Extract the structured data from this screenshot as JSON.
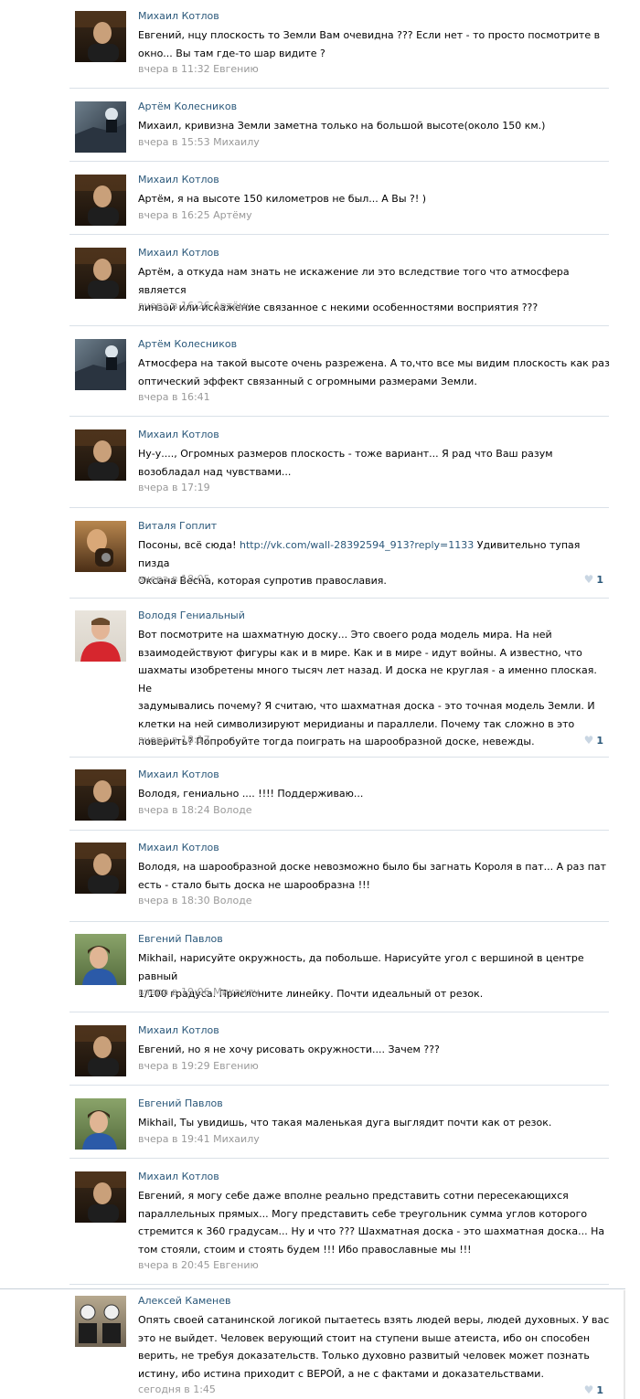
{
  "comments": [
    {
      "author": "Михаил Котлов",
      "avatar": "mikhail",
      "lines": [
        "Евгений, нцу плоскость то Земли Вам очевидна ??? Если нет - то просто посмотрите в",
        "окно... Вы там где-то шар видите ?"
      ],
      "time": "вчера в 11:32",
      "reply_to": "Евгению"
    },
    {
      "author": "Артём Колесников",
      "avatar": "artem",
      "lines": [
        "Михаил, кривизна Земли заметна только на большой высоте(около 150 км.)"
      ],
      "time": "вчера в 15:53",
      "reply_to": "Михаилу"
    },
    {
      "author": "Михаил Котлов",
      "avatar": "mikhail",
      "lines": [
        "Артём, я на высоте 150 километров не был... А Вы ?! )"
      ],
      "time": "вчера в 16:25",
      "reply_to": "Артёму"
    },
    {
      "author": "Михаил Котлов",
      "avatar": "mikhail",
      "lines": [
        "Артём, а откуда нам знать не искажение ли это вследствие того что атмосфера является",
        "линзой или искажение связанное с некими особенностями восприятия ???"
      ],
      "time": "вчера в 16:26",
      "reply_to": "Артёму"
    },
    {
      "author": "Артём Колесников",
      "avatar": "artem",
      "lines": [
        "Атмосфера на такой высоте очень разрежена. А то,что все мы видим плоскость как раз",
        "оптический эффект связанный с огромными размерами Земли."
      ],
      "time": "вчера в 16:41",
      "reply_to": ""
    },
    {
      "author": "Михаил Котлов",
      "avatar": "mikhail",
      "lines": [
        "Ну-у...., Огромных размеров плоскость - тоже вариант... Я рад что Ваш разум",
        "возобладал над чувствами..."
      ],
      "time": "вчера в 17:19",
      "reply_to": ""
    },
    {
      "author": "Виталя Гоплит",
      "avatar": "vitalya",
      "lines_html": true,
      "line1_pre": "Посоны, всё сюда! ",
      "line1_link": "http://vk.com/wall-28392594_913?reply=1133",
      "line1_post": " Удивительно тупая пизда",
      "lines": [
        "Оксана Весна, которая супротив православия."
      ],
      "time": "вчера в 18:05",
      "reply_to": "",
      "likes": "1"
    },
    {
      "author": "Володя Гениальный",
      "avatar": "volodya",
      "lines": [
        "Вот посмотрите на шахматную доску... Это своего рода модель мира. На ней",
        "взаимодействуют фигуры как и в мире. Как и в мире - идут войны. А известно, что",
        "шахматы изобретены много тысяч лет назад. И доска не круглая - а именно плоская. Не",
        "задумывались почему? Я считаю, что шахматная доска - это точная модель Земли. И",
        "клетки на ней символизируют меридианы и параллели. Почему так сложно в это",
        "поверить? Попробуйте тогда поиграть на шарообразной доске, невежды."
      ],
      "time": "вчера в 18:17",
      "reply_to": "",
      "likes": "1"
    },
    {
      "author": "Михаил Котлов",
      "avatar": "mikhail",
      "lines": [
        "Володя, гениально .... !!!! Поддерживаю..."
      ],
      "time": "вчера в 18:24",
      "reply_to": "Володе"
    },
    {
      "author": "Михаил Котлов",
      "avatar": "mikhail",
      "lines": [
        "Володя, на шарообразной доске невозможно было бы загнать Короля в пат... А раз пат",
        "есть - стало быть доска не шарообразна !!!"
      ],
      "time": "вчера в 18:30",
      "reply_to": "Володе"
    },
    {
      "author": "Евгений Павлов",
      "avatar": "evgeny",
      "lines": [
        "Mikhail, нарисуйте окружность, да побольше. Нарисуйте угол с вершиной в центре равный",
        "1/100 градуса. Прислоните линейку. Почти идеальный от резок."
      ],
      "time": "вчера в 19:06",
      "reply_to": "Михаилу"
    },
    {
      "author": "Михаил Котлов",
      "avatar": "mikhail",
      "lines": [
        "Евгений, но я не хочу рисовать окружности.... Зачем ???"
      ],
      "time": "вчера в 19:29",
      "reply_to": "Евгению"
    },
    {
      "author": "Евгений Павлов",
      "avatar": "evgeny",
      "lines": [
        "Mikhail, Ты увидишь, что такая маленькая дуга выглядит почти как от резок."
      ],
      "time": "вчера в 19:41",
      "reply_to": "Михаилу"
    },
    {
      "author": "Михаил Котлов",
      "avatar": "mikhail",
      "lines": [
        "Евгений, я могу себе даже вполне реально представить сотни пересекающихся",
        "параллельных прямых... Могу представить себе треугольник сумма углов которого",
        "стремится к 360 градусам... Ну и что ??? Шахматная доска - это шахматная доска... На",
        "том стояли, стоим и стоять будем !!! Ибо православные мы !!!"
      ],
      "time": "вчера в 20:45",
      "reply_to": "Евгению"
    },
    {
      "author": "Алексей Каменев",
      "avatar": "alexey",
      "lines": [
        "Опять своей сатанинской логикой пытаетесь взять людей веры, людей духовных. У вас",
        "это не выйдет. Человек верующий стоит на ступени выше атеиста, ибо он способен",
        "верить, не требуя доказательств. Только духовно развитый человек может познать",
        "истину, ибо истина приходит с ВЕРОЙ, а не с фактами и доказательствами."
      ],
      "time": "сегодня в 1:45",
      "reply_to": "",
      "likes": "1"
    }
  ],
  "colors": {
    "link": "#2b587a",
    "meta": "#999999",
    "divider": "#dae1e8",
    "heart": "#c9d6e3"
  },
  "icons": {
    "like": "heart-icon"
  }
}
